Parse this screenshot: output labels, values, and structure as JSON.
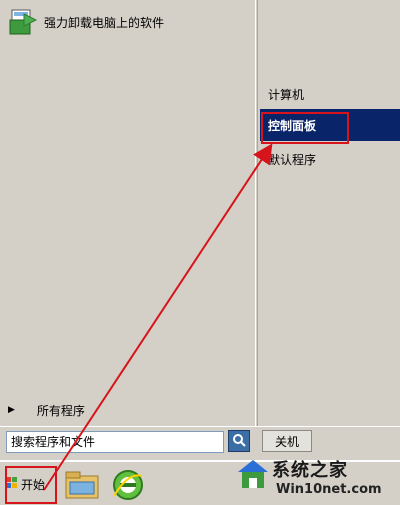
{
  "start_menu": {
    "pinned_app_label": "强力卸载电脑上的软件",
    "all_programs_label": "所有程序",
    "right_items": {
      "computer": "计算机",
      "control_panel": "控制面板",
      "default_programs": "默认程序"
    },
    "search_placeholder": "搜索程序和文件",
    "shutdown_label": "关机"
  },
  "taskbar": {
    "start_label": "开始"
  },
  "watermark": {
    "title": "系统之家",
    "url": "Win10net.com"
  },
  "colors": {
    "highlight": "#0a246a",
    "annotation": "#d7141b",
    "panel": "#d4d0c8"
  }
}
